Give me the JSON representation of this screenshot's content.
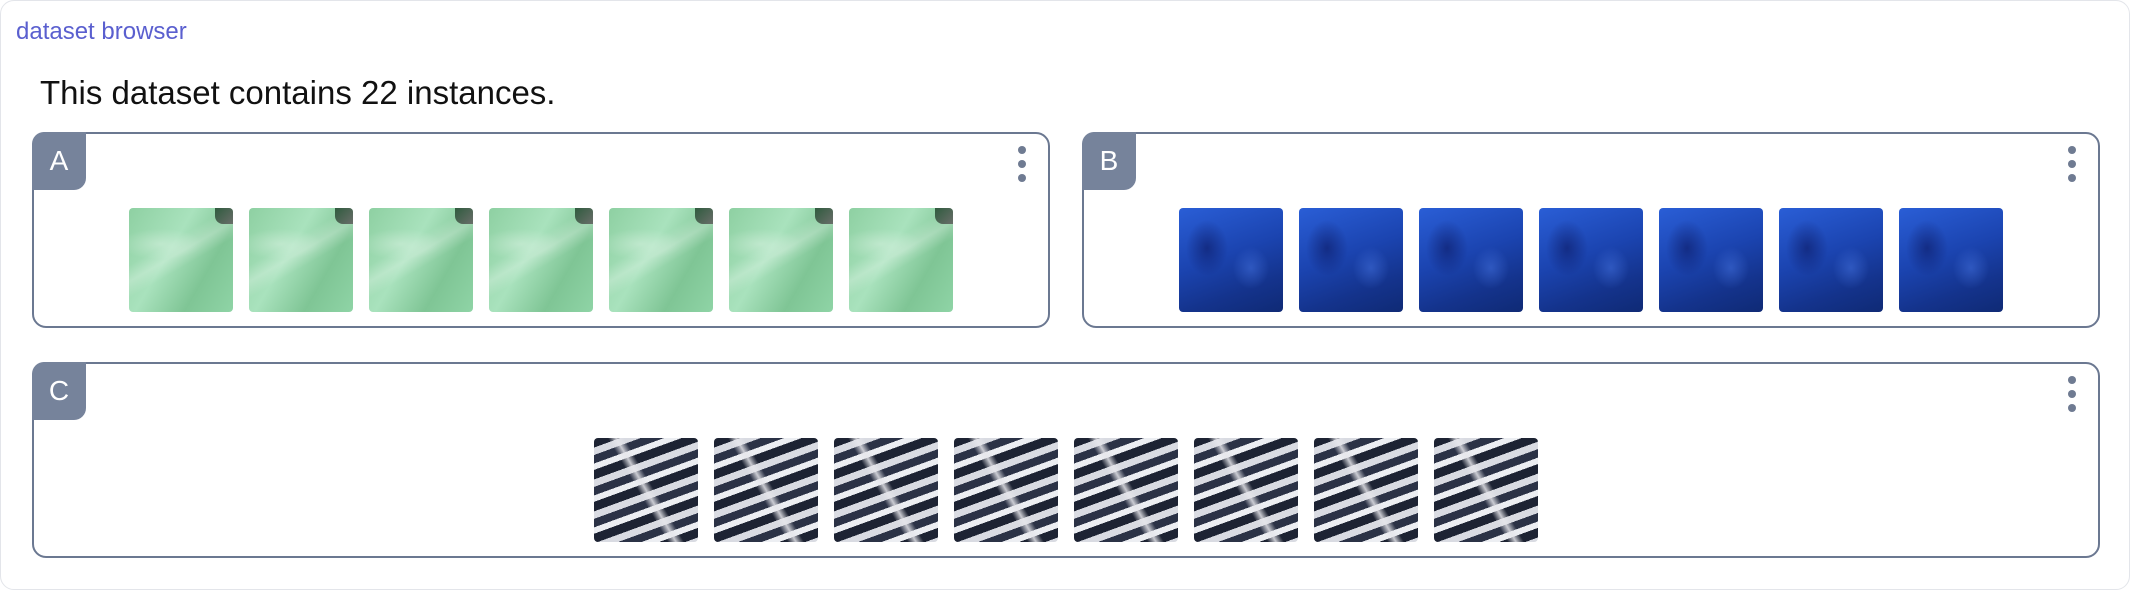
{
  "breadcrumb": {
    "label": "dataset browser"
  },
  "summary": {
    "text": "This dataset contains 22 instances."
  },
  "groups": [
    {
      "label": "A",
      "thumb_count": 7,
      "swatch": "green"
    },
    {
      "label": "B",
      "thumb_count": 7,
      "swatch": "blue"
    },
    {
      "label": "C",
      "thumb_count": 8,
      "swatch": "stripe"
    }
  ],
  "colors": {
    "link": "#5a5fcf",
    "card_border": "#6b7891",
    "label_badge": "#76839b"
  },
  "icons": {
    "menu": "more-vertical-icon"
  }
}
